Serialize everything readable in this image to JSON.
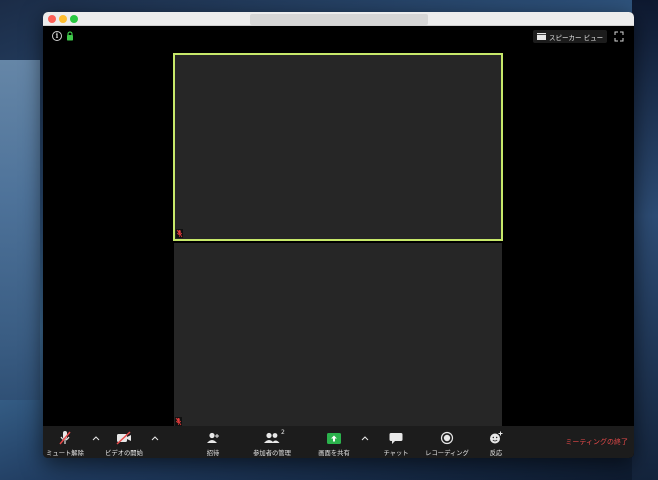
{
  "window": {
    "traffic_lights": {
      "close": "#fc5f57",
      "minimize": "#fdbc2e",
      "zoom": "#28c840"
    }
  },
  "top_bar": {
    "info_icon": "info-icon",
    "lock_icon": "lock-icon",
    "view_label": "スピーカー ビュー",
    "fullscreen_icon": "fullscreen-icon"
  },
  "videos": {
    "active_border_color": "#c7e86a",
    "tiles": [
      {
        "muted_icon": "muted-mic-icon"
      },
      {
        "muted_icon": "muted-mic-icon"
      }
    ]
  },
  "toolbar": {
    "unmute_label": "ミュート解除",
    "start_video_label": "ビデオの開始",
    "invite_label": "招待",
    "manage_participants_label": "参加者の管理",
    "participants_count": "2",
    "share_screen_label": "画面を共有",
    "chat_label": "チャット",
    "record_label": "レコーディング",
    "reactions_label": "反応",
    "end_meeting_label": "ミーティングの終了",
    "share_color": "#2bb24c",
    "end_color": "#e84a4a"
  }
}
